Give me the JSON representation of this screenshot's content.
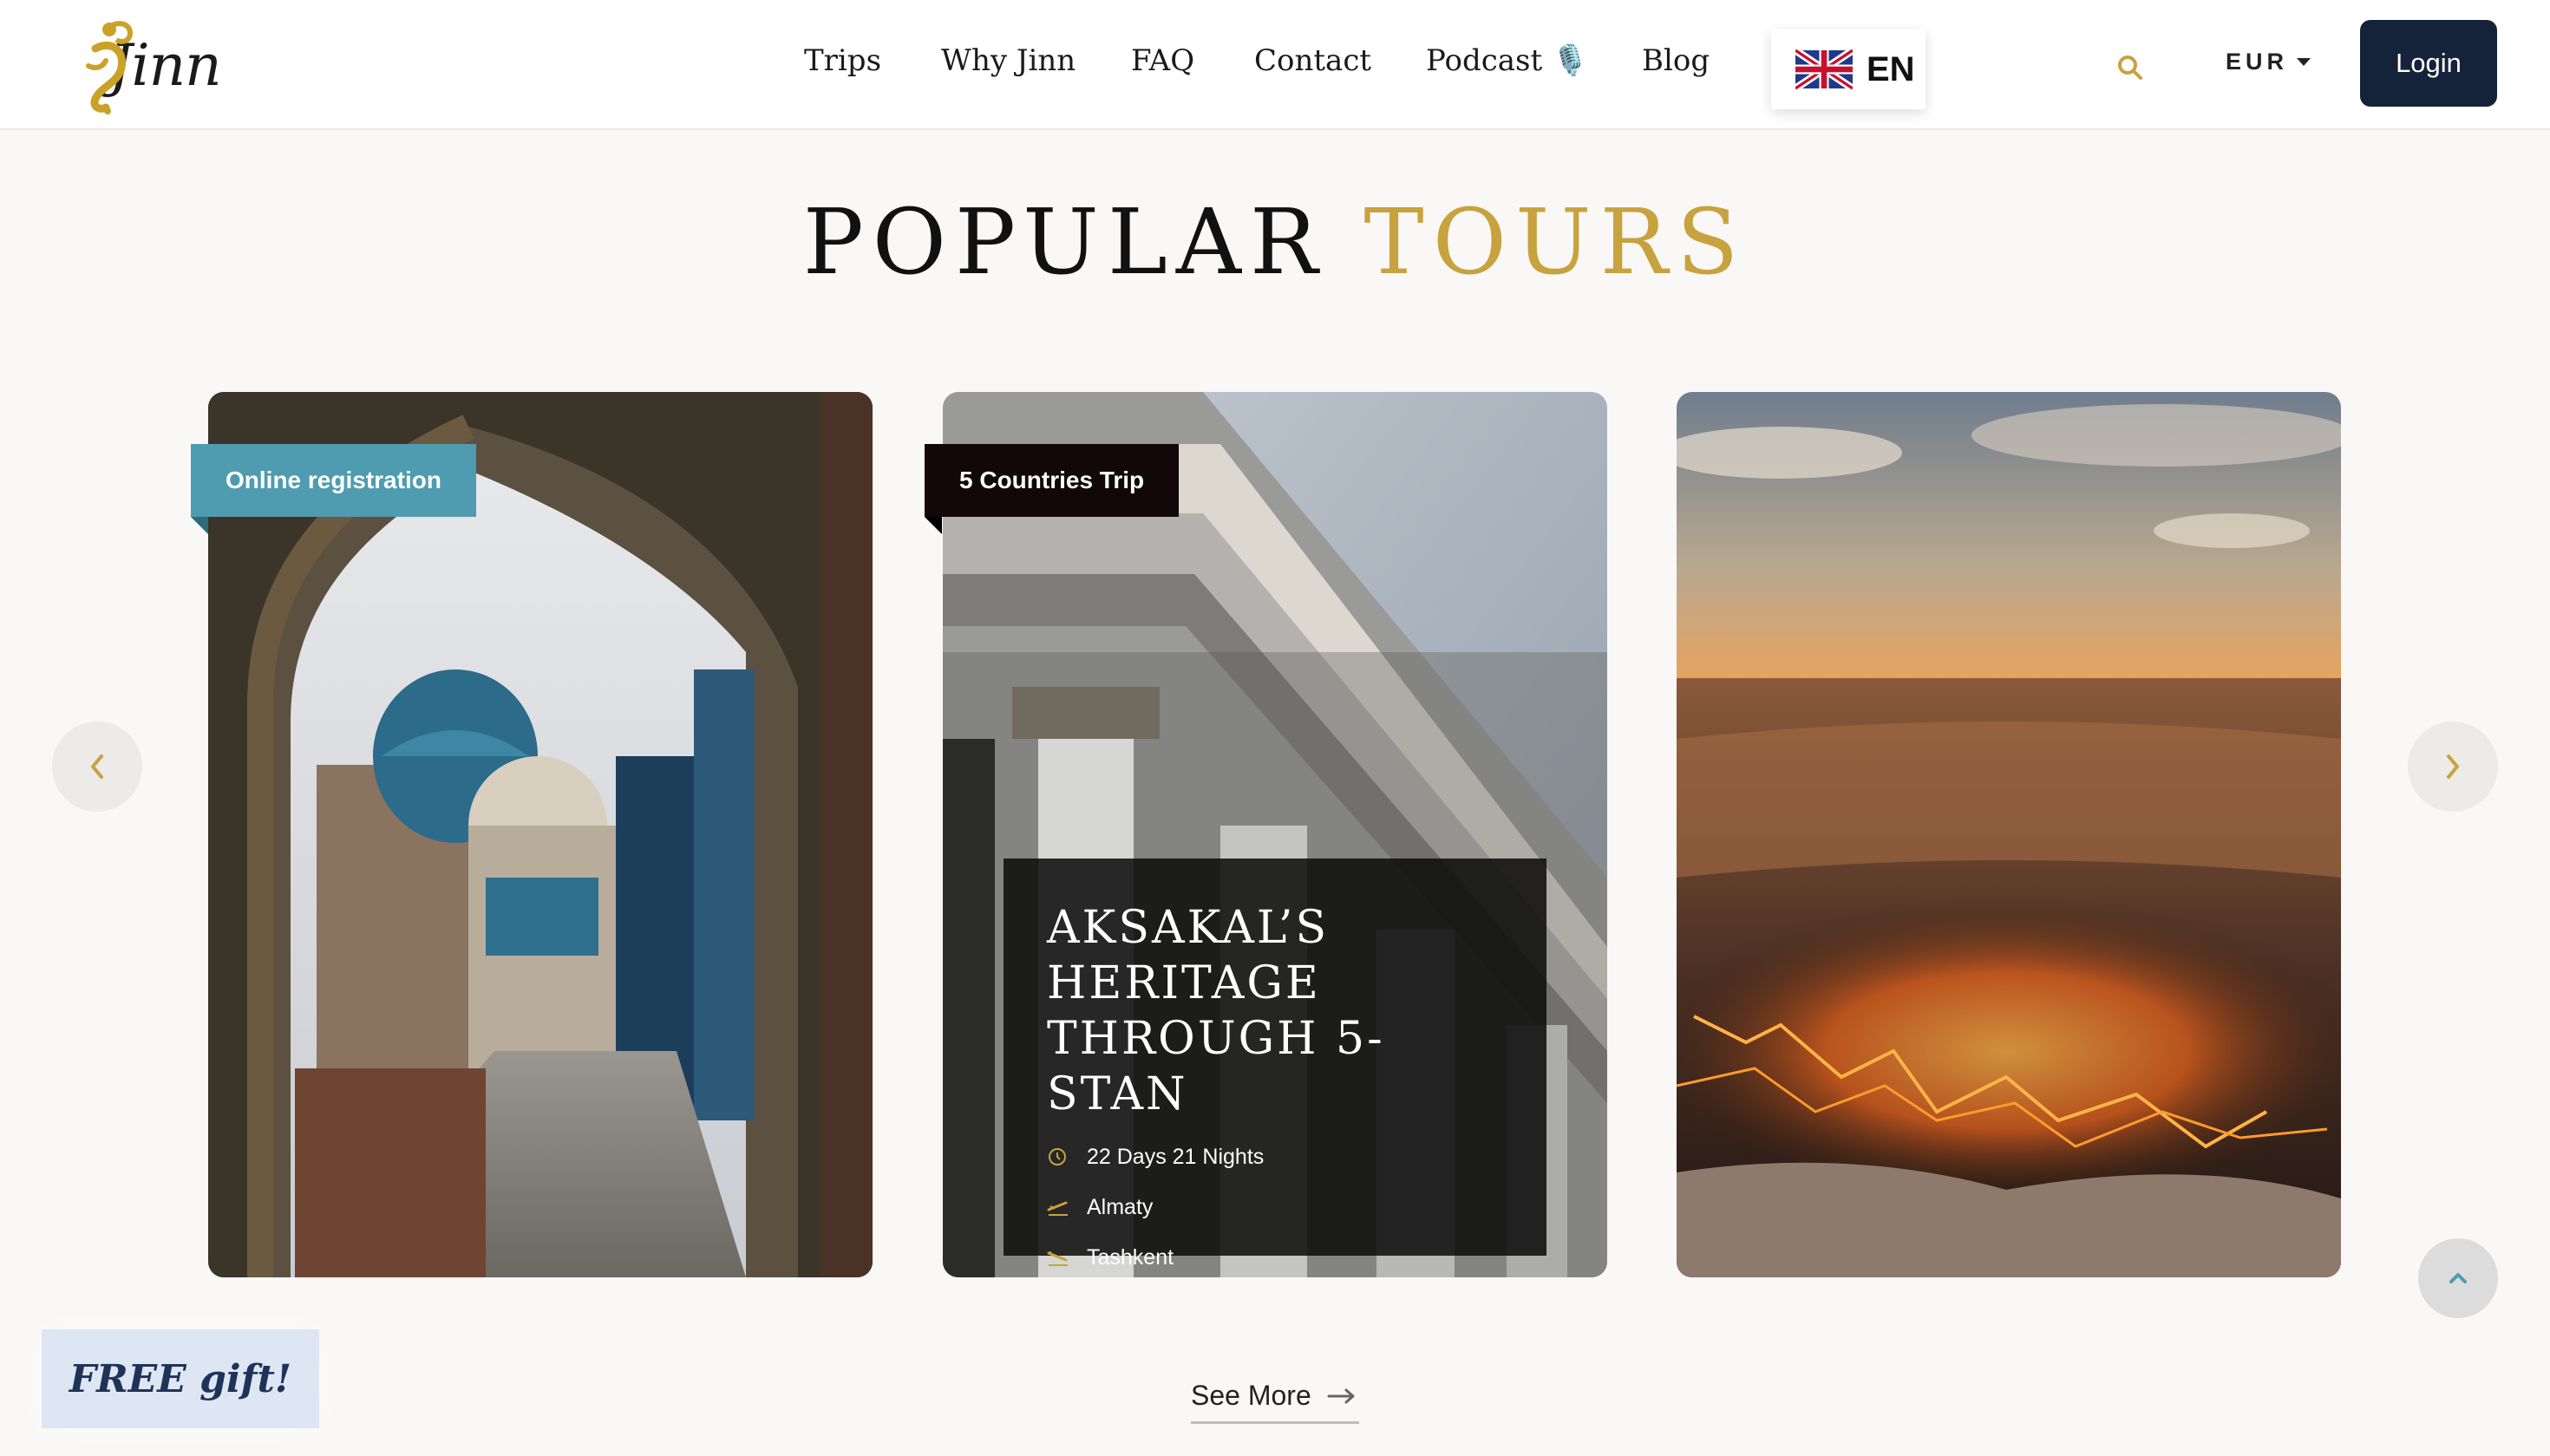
{
  "header": {
    "logo_text": "Jinn",
    "nav": [
      "Trips",
      "Why Jinn",
      "FAQ",
      "Contact",
      "Podcast 🎙️",
      "Blog"
    ],
    "language": "EN",
    "currency": "EUR",
    "login_label": "Login"
  },
  "section": {
    "title_part1": "POPULAR",
    "title_part2": "TOURS"
  },
  "cards": [
    {
      "badge": "Online registration",
      "badge_color": "#4f9cb0"
    },
    {
      "badge": "5 Countries Trip",
      "badge_color": "#120809",
      "title": "Aksakal’s Heritage Through 5-stan",
      "duration": "22 Days 21 Nights",
      "departure": "Almaty",
      "arrival": "Tashkent"
    },
    {
      "badge": ""
    }
  ],
  "see_more_label": "See More",
  "gift_label": "FREE gift!",
  "colors": {
    "accent_gold": "#c7a23e",
    "navy": "#14233a",
    "teal": "#4f9cb0"
  }
}
